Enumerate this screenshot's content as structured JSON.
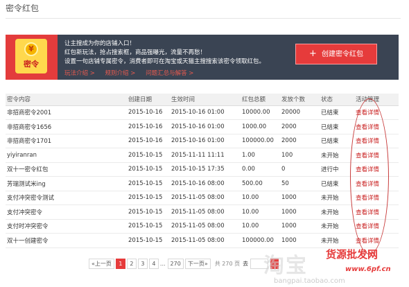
{
  "page": {
    "title": "密令红包"
  },
  "banner": {
    "icon_word": "密令",
    "icon_coin": "¥",
    "lines": [
      "让主搜成为你的店铺入口！",
      "红包新玩法，抢占搜索框，商品强曝光，流量不再愁！",
      "设置一句店铺专属密令，消费者即可在淘宝或天猫主搜搜索该密令领取红包。"
    ],
    "links": [
      "玩法介绍 >",
      "规则介绍 >",
      "问题汇总与解答 >"
    ],
    "create_button": "创建密令红包",
    "create_button_icon": "+"
  },
  "table": {
    "headers": [
      "密令内容",
      "创建日期",
      "生效时间",
      "红包总额",
      "发放个数",
      "状态",
      "活动管理"
    ],
    "rows": [
      [
        "非招商密令2001",
        "2015-10-16",
        "2015-10-16 01:00",
        "10000.00",
        "20000",
        "已结束",
        "查看详情"
      ],
      [
        "非招商密令1656",
        "2015-10-16",
        "2015-10-16 01:00",
        "1000.00",
        "2000",
        "已结束",
        "查看详情"
      ],
      [
        "非招商密令1701",
        "2015-10-16",
        "2015-10-16 01:00",
        "100000.00",
        "2000",
        "已结束",
        "查看详情"
      ],
      [
        "yiyiranran",
        "2015-10-15",
        "2015-11-11 11:11",
        "1.00",
        "100",
        "未开始",
        "查看详情"
      ],
      [
        "双十一密令红包",
        "2015-10-15",
        "2015-10-15 17:35",
        "0.00",
        "0",
        "进行中",
        "查看详情"
      ],
      [
        "芳瑞测试米ing",
        "2015-10-15",
        "2015-10-16 08:00",
        "500.00",
        "50",
        "已结束",
        "查看详情"
      ],
      [
        "支付冲突密令测试",
        "2015-10-15",
        "2015-11-05 08:00",
        "10.00",
        "1000",
        "未开始",
        "查看详情"
      ],
      [
        "支付冲突密令",
        "2015-10-15",
        "2015-11-05 08:00",
        "10.00",
        "1000",
        "未开始",
        "查看详情"
      ],
      [
        "支付时冲突密令",
        "2015-10-15",
        "2015-11-05 08:00",
        "10.00",
        "1000",
        "未开始",
        "查看详情"
      ],
      [
        "双十一创建密令",
        "2015-10-15",
        "2015-11-05 08:00",
        "100000.00",
        "1000",
        "未开始",
        "查看详情"
      ]
    ]
  },
  "pager": {
    "prev": "«上一页",
    "pages": [
      "1",
      "2",
      "3",
      "4"
    ],
    "dots": "...",
    "last": "270",
    "next": "下一页»",
    "total": "共 270 页",
    "goto_label": "去"
  },
  "watermark": {
    "big": "淘宝",
    "logo": "货源批发网",
    "url": "www.6pf.cn",
    "url2": "bangpai.taobao.com"
  },
  "colors": {
    "accent": "#e63b3b",
    "banner_bg": "#3a4453",
    "link": "#c81e1e"
  }
}
